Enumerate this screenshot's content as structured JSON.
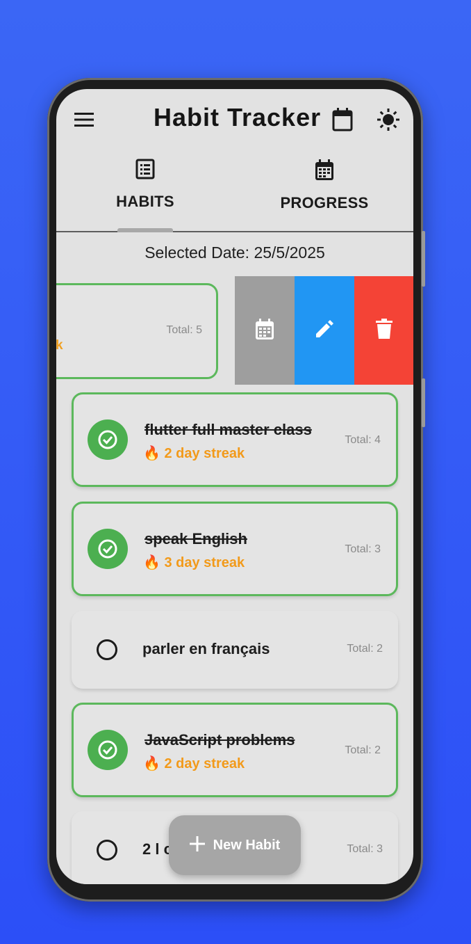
{
  "app": {
    "title": "Habit Tracker",
    "menu_icon": "menu-icon",
    "calendar_icon": "calendar-icon",
    "theme_icon": "sun-icon"
  },
  "tabs": [
    {
      "label": "HABITS",
      "icon": "list-icon",
      "selected": true
    },
    {
      "label": "PROGRESS",
      "icon": "calendar-grid-icon",
      "selected": false
    }
  ],
  "selected_date": "Selected Date: 25/5/2025",
  "swiped_habit": {
    "total": "Total: 5",
    "streak_fragment": "k",
    "actions": [
      {
        "name": "calendar",
        "icon": "calendar-grid-icon",
        "color": "#9e9e9e"
      },
      {
        "name": "edit",
        "icon": "pencil-icon",
        "color": "#2196f3"
      },
      {
        "name": "delete",
        "icon": "trash-icon",
        "color": "#f44336"
      }
    ]
  },
  "habits": [
    {
      "name": "flutter full master class",
      "completed": true,
      "streak": "2 day streak",
      "total": "Total: 4"
    },
    {
      "name": "speak English",
      "completed": true,
      "streak": "3 day streak",
      "total": "Total: 3"
    },
    {
      "name": "parler en français",
      "completed": false,
      "streak": "",
      "total": "Total: 2"
    },
    {
      "name": "JavaScript problems",
      "completed": true,
      "streak": "2 day streak",
      "total": "Total: 2"
    },
    {
      "name": "2 l c",
      "completed": false,
      "streak": "",
      "total": "Total: 3"
    }
  ],
  "streak_emoji": "🔥",
  "fab": {
    "label": "New Habit",
    "icon": "plus-icon"
  },
  "colors": {
    "accent_green": "#4caf50",
    "streak_orange": "#f29a1a",
    "background": "#3b66f5"
  }
}
